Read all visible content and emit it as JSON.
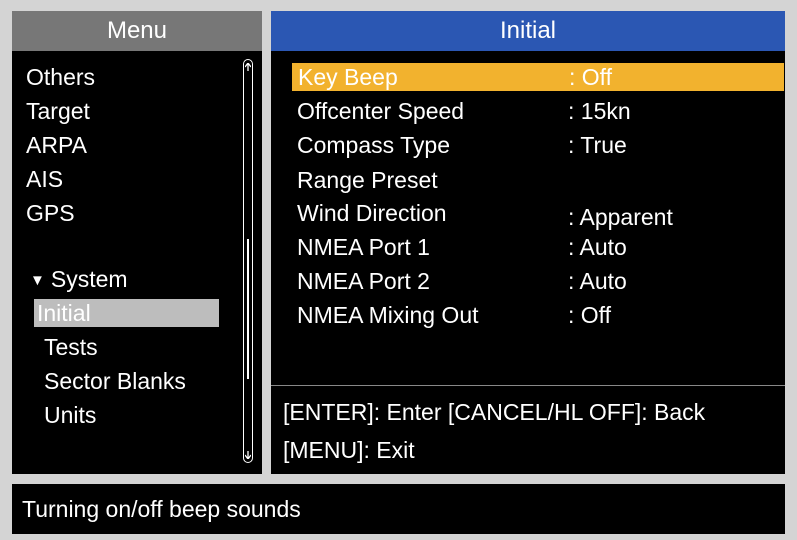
{
  "menu": {
    "title": "Menu",
    "items": [
      {
        "label": "Others"
      },
      {
        "label": "Target"
      },
      {
        "label": "ARPA"
      },
      {
        "label": "AIS"
      },
      {
        "label": "GPS"
      },
      {
        "label": "System"
      },
      {
        "label": "Initial"
      },
      {
        "label": "Tests"
      },
      {
        "label": "Sector Blanks"
      },
      {
        "label": "Units"
      }
    ],
    "expanded_group": "System",
    "selected": "Initial"
  },
  "initial": {
    "title": "Initial",
    "rows": [
      {
        "label": "Key Beep",
        "value": ": Off"
      },
      {
        "label": "Offcenter Speed",
        "value": ": 15kn"
      },
      {
        "label": "Compass Type",
        "value": ": True"
      },
      {
        "label": "Range Preset",
        "value": ""
      },
      {
        "label": "Wind Direction",
        "value": ": Apparent"
      },
      {
        "label": "NMEA Port 1",
        "value": ": Auto"
      },
      {
        "label": "NMEA Port 2",
        "value": ": Auto"
      },
      {
        "label": "NMEA Mixing Out",
        "value": ": Off"
      }
    ],
    "footer": {
      "line1": "[ENTER]: Enter [CANCEL/HL OFF]: Back",
      "line2": "[MENU]: Exit"
    }
  },
  "help": {
    "text": "Turning on/off beep sounds"
  },
  "colors": {
    "menu_header": "#777777",
    "panel_header": "#2b57b3",
    "highlight": "#f2b22e",
    "menu_selected": "#bdbdbd"
  }
}
